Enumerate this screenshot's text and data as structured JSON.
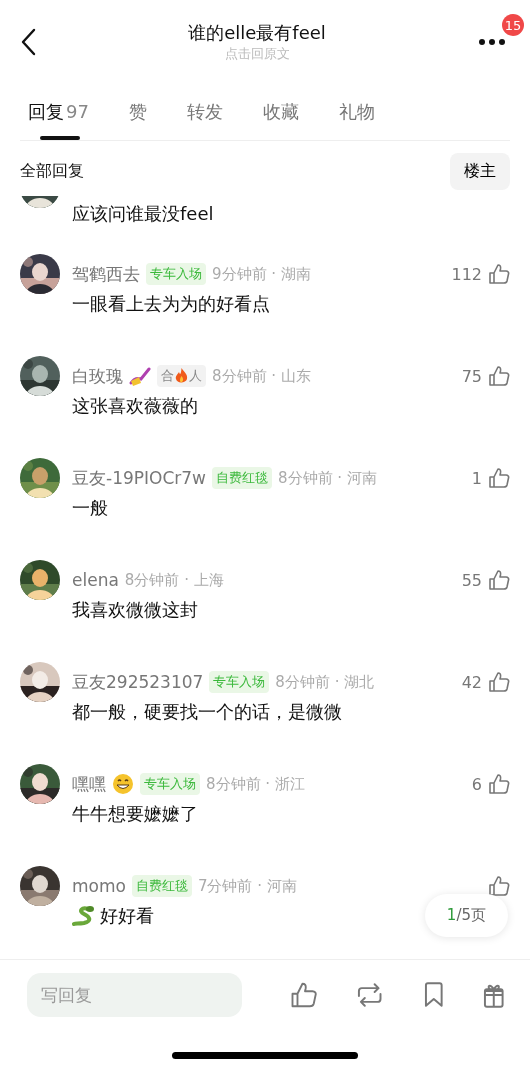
{
  "header": {
    "title": "谁的elle最有feel",
    "subtitle": "点击回原文",
    "notification_count": "15"
  },
  "tabs": [
    {
      "label": "回复",
      "count": "97",
      "selected": true
    },
    {
      "label": "赞",
      "selected": false
    },
    {
      "label": "转发",
      "selected": false
    },
    {
      "label": "收藏",
      "selected": false
    },
    {
      "label": "礼物",
      "selected": false
    }
  ],
  "filter": {
    "label": "全部回复",
    "button": "楼主"
  },
  "comments": [
    {
      "partial": true,
      "text": "应该问谁最没feel"
    },
    {
      "name": "驾鹤西去",
      "tag": {
        "kind": "green",
        "text": "专车入场"
      },
      "meta": "9分钟前 · 湖南",
      "likes": "112",
      "text": "一眼看上去为为的好看点"
    },
    {
      "name": "白玫瑰",
      "name_icon": {
        "kind": "nail-polish"
      },
      "tag": {
        "kind": "fire",
        "before": "合",
        "after": "人"
      },
      "meta": "8分钟前 · 山东",
      "likes": "75",
      "text": "这张喜欢薇薇的"
    },
    {
      "name": "豆友-19PIOCr7w",
      "tag": {
        "kind": "green",
        "text": "自费红毯"
      },
      "meta": "8分钟前 · 河南",
      "likes": "1",
      "text": "一般"
    },
    {
      "name": "elena",
      "meta": "8分钟前 · 上海",
      "likes": "55",
      "text": "我喜欢微微这封"
    },
    {
      "name": "豆友292523107",
      "tag": {
        "kind": "green",
        "text": "专车入场"
      },
      "meta": "8分钟前 · 湖北",
      "likes": "42",
      "text": "都一般，硬要找一个的话，是微微"
    },
    {
      "name": "嘿嘿",
      "name_icon": {
        "kind": "grin"
      },
      "tag": {
        "kind": "green",
        "text": "专车入场"
      },
      "meta": "8分钟前 · 浙江",
      "likes": "6",
      "text": "牛牛想要嬷嬷了"
    },
    {
      "name": "momo",
      "tag": {
        "kind": "green",
        "text": "自费红毯"
      },
      "meta": "7分钟前 · 河南",
      "text": "好好看",
      "lead_icon": {
        "kind": "snake"
      }
    }
  ],
  "pager": {
    "current": "1",
    "rest": "/5页"
  },
  "composer": {
    "placeholder": "写回复"
  }
}
